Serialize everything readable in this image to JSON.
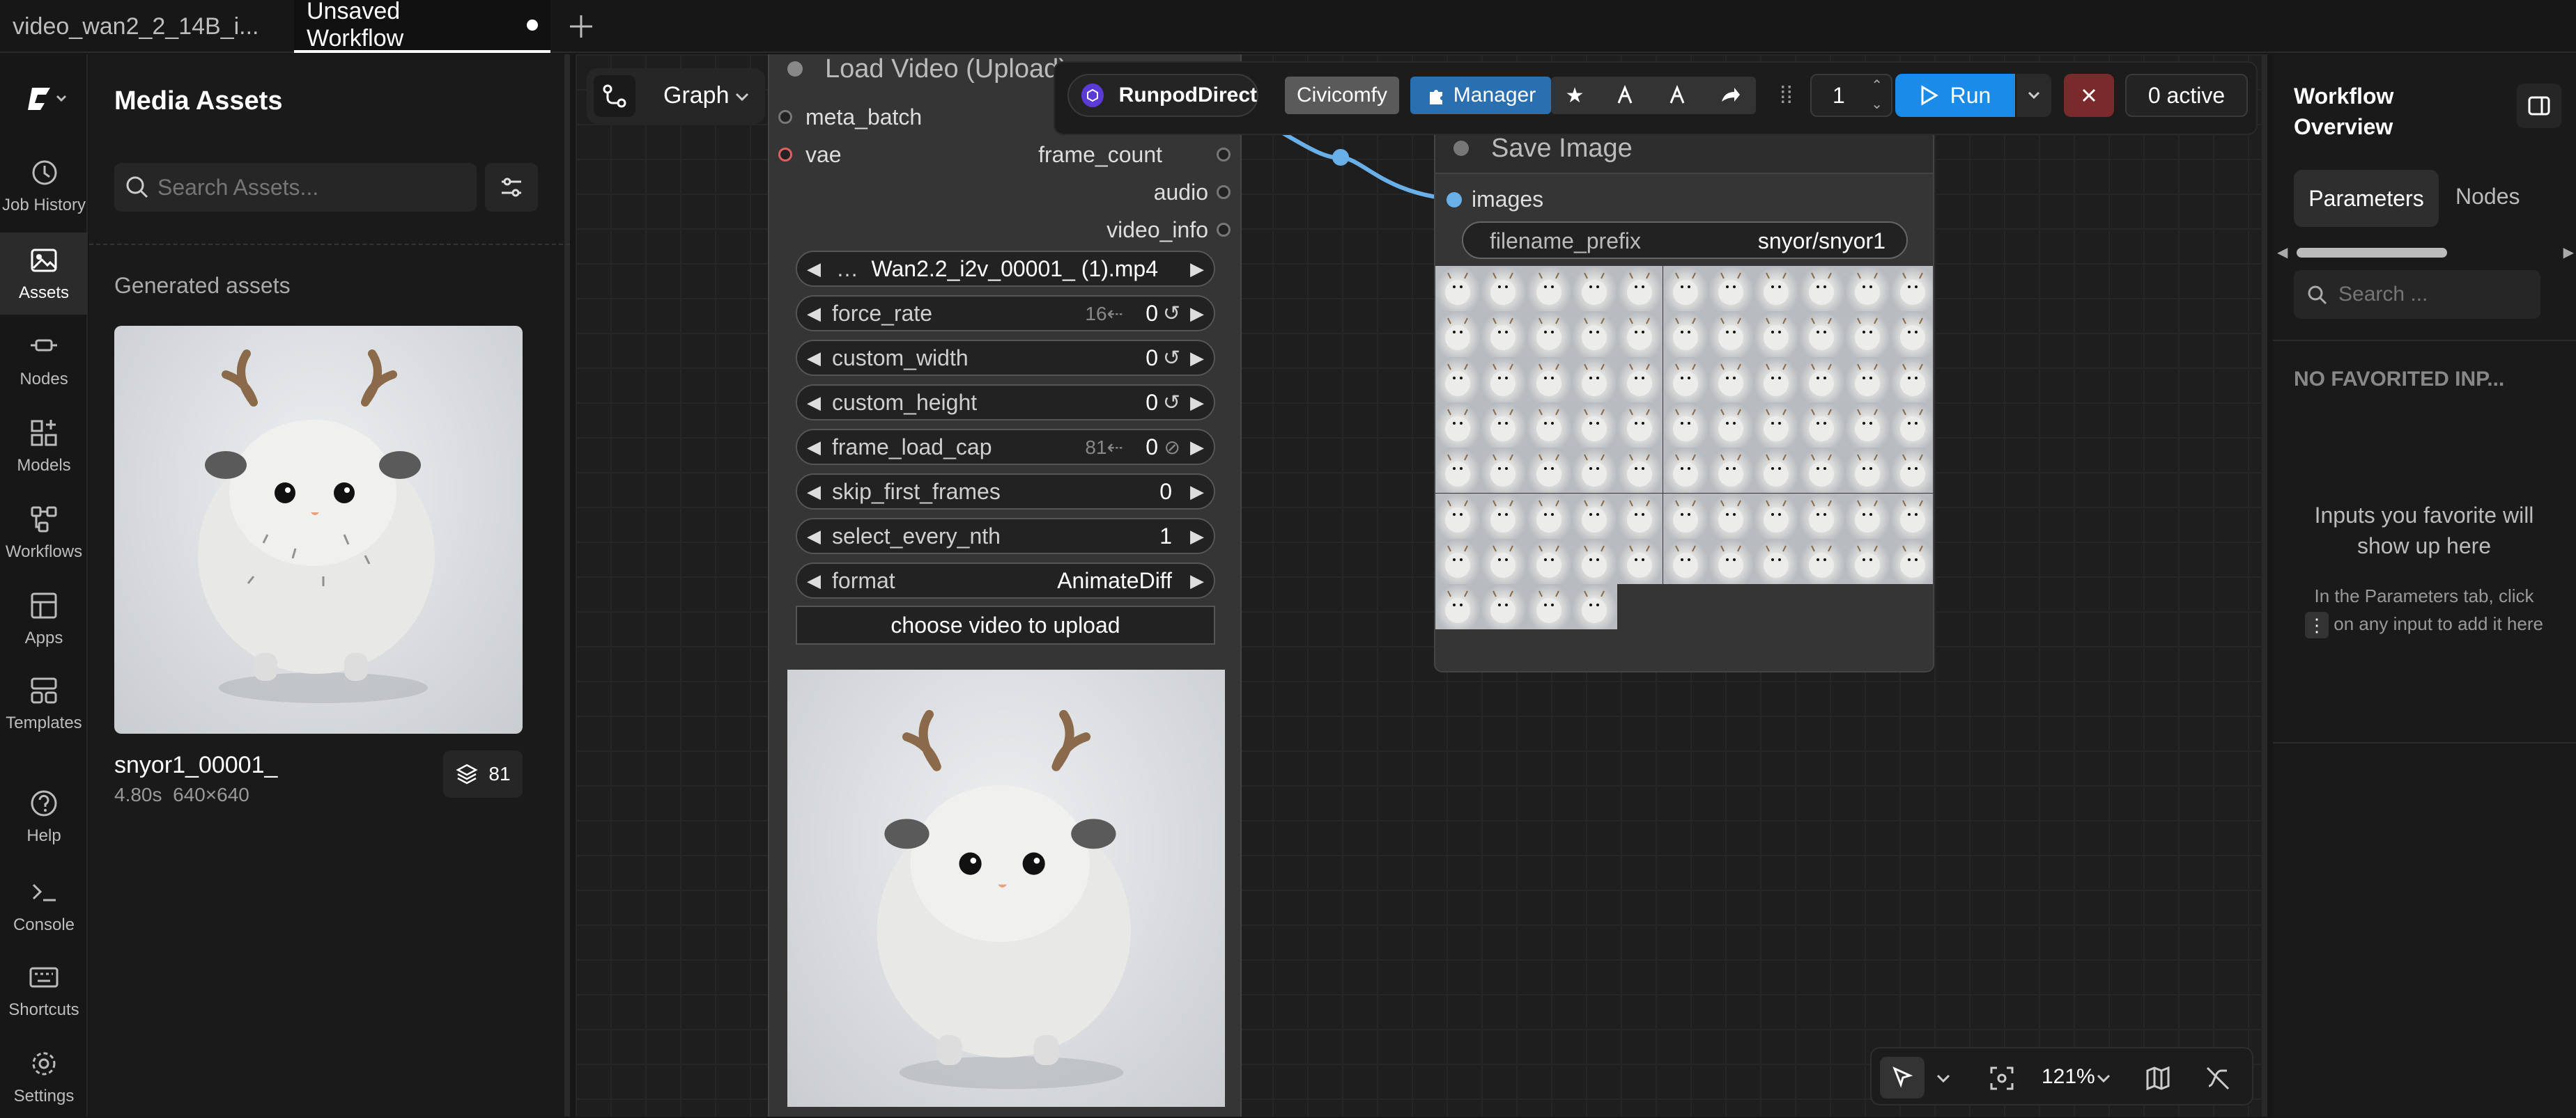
{
  "tabs": [
    {
      "label": "video_wan2_2_14B_i...",
      "active": false
    },
    {
      "label": "Unsaved Workflow",
      "active": true
    }
  ],
  "rail": {
    "items": [
      {
        "label": "Job History",
        "icon": "history-icon"
      },
      {
        "label": "Assets",
        "icon": "image-icon"
      },
      {
        "label": "Nodes",
        "icon": "nodes-icon"
      },
      {
        "label": "Models",
        "icon": "models-icon"
      },
      {
        "label": "Workflows",
        "icon": "workflows-icon"
      },
      {
        "label": "Apps",
        "icon": "apps-icon"
      },
      {
        "label": "Templates",
        "icon": "templates-icon"
      },
      {
        "label": "Help",
        "icon": "help-icon"
      },
      {
        "label": "Console",
        "icon": "console-icon"
      },
      {
        "label": "Shortcuts",
        "icon": "keyboard-icon"
      },
      {
        "label": "Settings",
        "icon": "gear-icon"
      }
    ]
  },
  "assets": {
    "title": "Media Assets",
    "search_placeholder": "Search Assets...",
    "section": "Generated assets",
    "item": {
      "name": "snyor1_00001_",
      "duration": "4.80s",
      "size": "640×640",
      "count": "81"
    }
  },
  "canvas": {
    "graph_label": "Graph",
    "load_node": {
      "title": "Load Video (Upload)",
      "inputs": [
        "meta_batch",
        "vae"
      ],
      "outputs": [
        "frame_count",
        "audio",
        "video_info"
      ],
      "widgets": [
        {
          "name": "",
          "value": "Wan2.2_i2v_00001_ (1).mp4",
          "hint": ""
        },
        {
          "name": "force_rate",
          "value": "0",
          "hint": "16⇠"
        },
        {
          "name": "custom_width",
          "value": "0",
          "hint": ""
        },
        {
          "name": "custom_height",
          "value": "0",
          "hint": ""
        },
        {
          "name": "frame_load_cap",
          "value": "0",
          "hint": "81⇠"
        },
        {
          "name": "skip_first_frames",
          "value": "0",
          "hint": ""
        },
        {
          "name": "select_every_nth",
          "value": "1",
          "hint": ""
        },
        {
          "name": "format",
          "value": "AnimateDiff",
          "hint": ""
        }
      ],
      "upload_button": "choose video to upload"
    },
    "save_node": {
      "title": "Save Image",
      "input": "images",
      "widget_name": "filename_prefix",
      "widget_value": "snyor/snyor1",
      "thumbnail_count": 81
    },
    "zoom": "121%"
  },
  "toolbar": {
    "runpod": "RunpodDirect",
    "civicomfy": "Civicomfy",
    "manager": "Manager",
    "batch_count": "1",
    "run": "Run",
    "active": "0 active"
  },
  "right": {
    "title": "Workflow Overview",
    "tab_params": "Parameters",
    "tab_nodes": "Nodes",
    "search_placeholder": "Search ...",
    "empty_title": "NO FAVORITED INP...",
    "empty_msg": "Inputs you favorite will show up here",
    "hint_a": "In the Parameters tab, click",
    "hint_b": "on any input to add it here"
  },
  "colors": {
    "accent": "#1a8be8",
    "manager": "#2a6fb0",
    "stop": "#7a2a2a",
    "link": "#6ab0e8"
  }
}
